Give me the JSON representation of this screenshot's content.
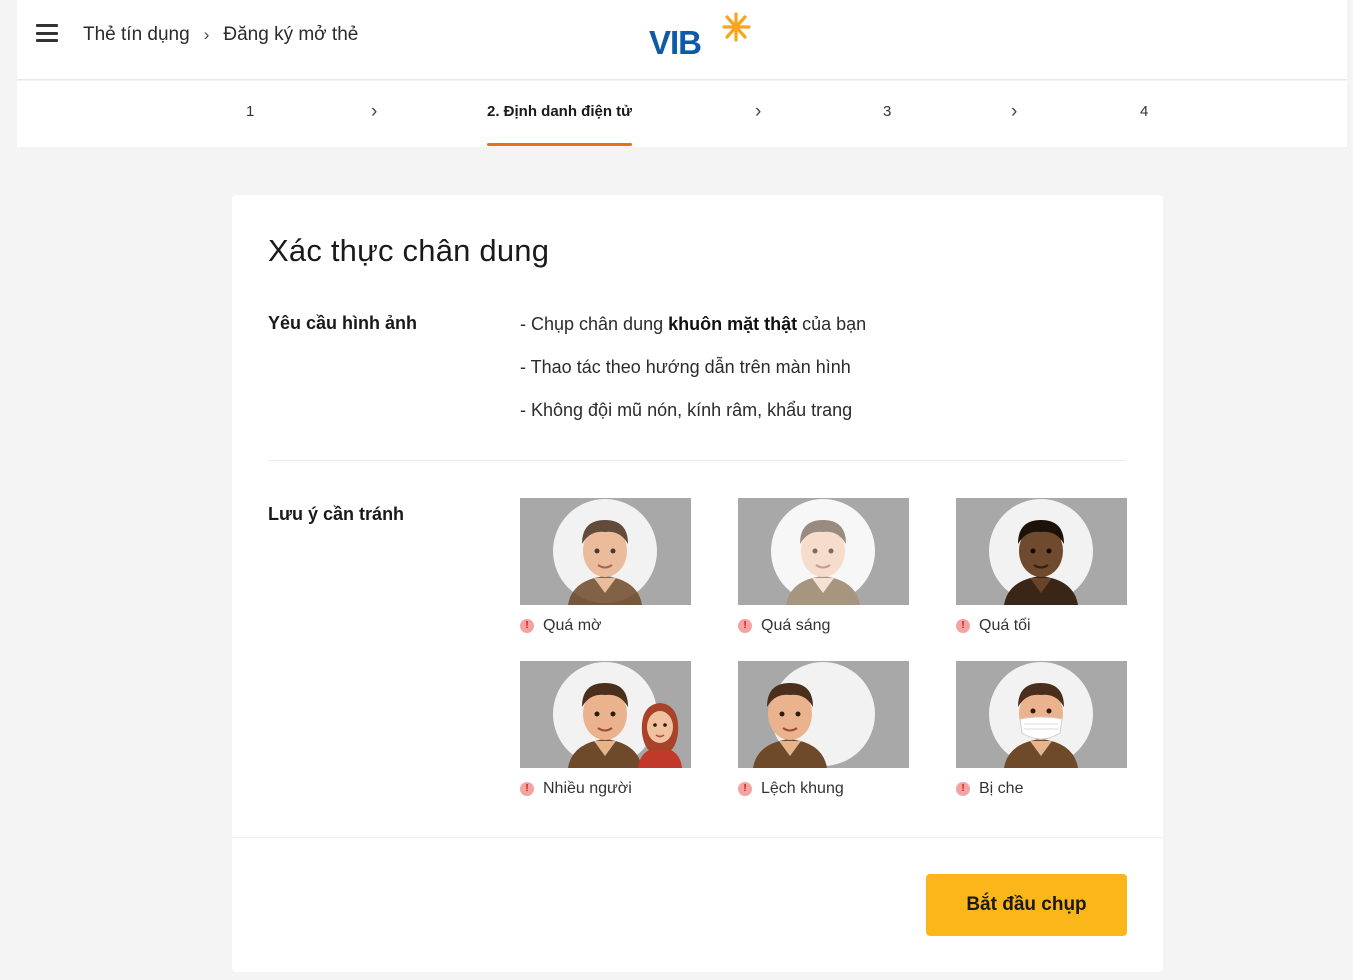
{
  "header": {
    "breadcrumb": [
      "Thẻ tín dụng",
      "Đăng ký mở thẻ"
    ],
    "logo_text": "VIB"
  },
  "stepper": {
    "steps": [
      "1",
      "2. Định danh điện tử",
      "3",
      "4"
    ],
    "active_index": 1,
    "accent_color": "#f26b1d"
  },
  "card": {
    "title": "Xác thực chân dung",
    "requirements_label": "Yêu cầu hình ảnh",
    "requirements": [
      {
        "prefix": "- Chụp chân dung ",
        "bold": "khuôn mặt thật",
        "suffix": " của bạn"
      },
      {
        "prefix": "- Thao tác theo hướng dẫn trên màn hình",
        "bold": "",
        "suffix": ""
      },
      {
        "prefix": "- Không đội mũ nón, kính râm, khẩu trang",
        "bold": "",
        "suffix": ""
      }
    ],
    "avoid_label": "Lưu ý cần tránh",
    "avoid_items": [
      {
        "label": "Quá mờ",
        "icon": "blurry-face-image"
      },
      {
        "label": "Quá sáng",
        "icon": "overexposed-face-image"
      },
      {
        "label": "Quá tối",
        "icon": "dark-face-image"
      },
      {
        "label": "Nhiều người",
        "icon": "multiple-people-image"
      },
      {
        "label": "Lệch khung",
        "icon": "off-frame-face-image"
      },
      {
        "label": "Bị che",
        "icon": "masked-face-image"
      }
    ],
    "start_button": "Bắt đầu chụp",
    "button_color": "#fbb61a"
  }
}
